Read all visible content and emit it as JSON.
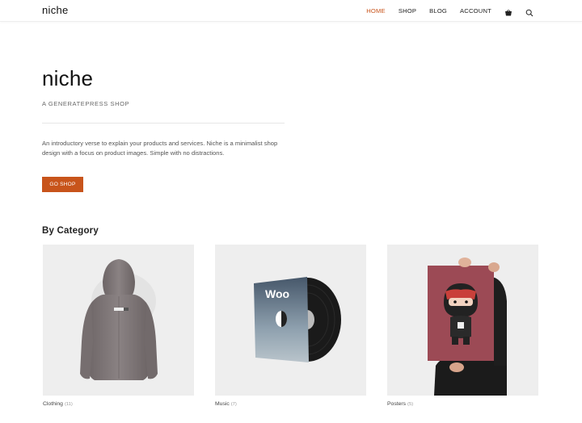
{
  "header": {
    "brand": "niche",
    "nav": [
      {
        "label": "HOME",
        "active": true
      },
      {
        "label": "SHOP",
        "active": false
      },
      {
        "label": "BLOG",
        "active": false
      },
      {
        "label": "ACCOUNT",
        "active": false
      }
    ],
    "icons": [
      "cart-icon",
      "search-icon"
    ]
  },
  "hero": {
    "title": "niche",
    "subtitle": "A GENERATEPRESS SHOP",
    "description": "An introductory verse to explain your products and services. Niche is a minimalist shop design with a focus on product images. Simple with no distractions.",
    "button_label": "GO SHOP"
  },
  "categories": {
    "heading": "By Category",
    "items": [
      {
        "name": "Clothing",
        "count": "(11)",
        "image": "hoodie-image"
      },
      {
        "name": "Music",
        "count": "(7)",
        "image": "woo-vinyl-album-image"
      },
      {
        "name": "Posters",
        "count": "(5)",
        "image": "ninja-poster-image"
      }
    ]
  },
  "colors": {
    "accent": "#c8541b",
    "card_background": "#eeeeee"
  }
}
